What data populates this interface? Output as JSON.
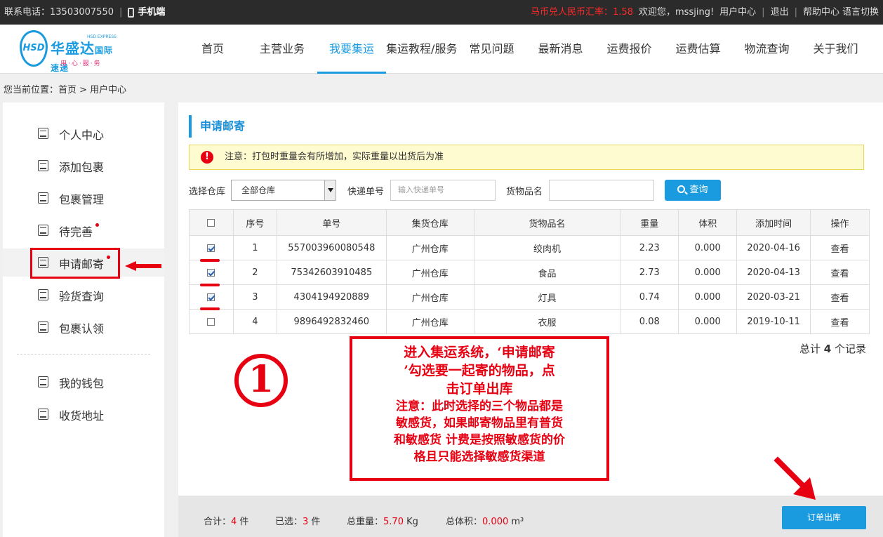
{
  "topbar": {
    "phone_label": "联系电话：13503007550",
    "mobile": "手机端",
    "rate_label": "马币兑人民币汇率：",
    "rate_value": "1.58",
    "welcome": "欢迎您，mssjing!",
    "user_center": "用户中心",
    "logout": "退出",
    "help": "帮助中心",
    "language": "语言切换"
  },
  "logo": {
    "badge": "HSD",
    "name": "华盛达",
    "subname": "国际速递",
    "en": "HSD EXPRESS",
    "slogan": "用·心·服·务"
  },
  "nav": [
    "首页",
    "主营业务",
    "我要集运",
    "集运教程/服务",
    "常见问题",
    "最新消息",
    "运费报价",
    "运费估算",
    "物流查询",
    "关于我们"
  ],
  "breadcrumb": "您当前位置：首页 > 用户中心",
  "sidebar": {
    "items": [
      "个人中心",
      "添加包裹",
      "包裹管理",
      "待完善",
      "申请邮寄",
      "验货查询",
      "包裹认领"
    ],
    "items2": [
      "我的钱包",
      "收货地址"
    ]
  },
  "panel": {
    "title": "申请邮寄",
    "notice": "注意：打包时重量会有所增加，实际重量以出货后为准",
    "notice_icon": "!"
  },
  "filter": {
    "warehouse_label": "选择仓库",
    "warehouse_value": "全部仓库",
    "tracking_label": "快递单号",
    "tracking_placeholder": "输入快递单号",
    "goods_label": "货物品名",
    "search_button": "查询"
  },
  "table": {
    "headers": [
      "序号",
      "单号",
      "集货仓库",
      "货物品名",
      "重量",
      "体积",
      "添加时间",
      "操作"
    ],
    "rows": [
      {
        "no": "1",
        "id": "557003960080548",
        "wh": "广州仓库",
        "name": "绞肉机",
        "weight": "2.23",
        "vol": "0.000",
        "date": "2020-04-16",
        "op": "查看"
      },
      {
        "no": "2",
        "id": "75342603910485",
        "wh": "广州仓库",
        "name": "食品",
        "weight": "2.73",
        "vol": "0.000",
        "date": "2020-04-13",
        "op": "查看"
      },
      {
        "no": "3",
        "id": "4304194920889",
        "wh": "广州仓库",
        "name": "灯具",
        "weight": "0.74",
        "vol": "0.000",
        "date": "2020-03-21",
        "op": "查看"
      },
      {
        "no": "4",
        "id": "9896492832460",
        "wh": "广州仓库",
        "name": "衣服",
        "weight": "0.08",
        "vol": "0.000",
        "date": "2019-10-11",
        "op": "查看"
      }
    ]
  },
  "total": {
    "pre": "总计 ",
    "count": "4",
    "post": " 个记录"
  },
  "annotation": {
    "step": "①",
    "line1": "进入集运系统，‘申请邮寄",
    "line2": "’勾选要一起寄的物品，点",
    "line3": "击订单出库",
    "line4": "注意：此时选择的三个物品都是",
    "line5": "敏感货，如果邮寄物品里有普货",
    "line6": "和敏感货 计费是按照敏感货的价",
    "line7": "格且只能选择敏感货渠道"
  },
  "bottom": {
    "total_label": "合计：",
    "total_val": "4",
    "total_unit": " 件",
    "sel_label": "已选：",
    "sel_val": "3",
    "sel_unit": " 件",
    "weight_label": "总重量：",
    "weight_val": "5.70",
    "weight_unit": " Kg",
    "vol_label": "总体积：",
    "vol_val": "0.000",
    "vol_unit": " m³",
    "order_button": "订单出库"
  },
  "colors": {
    "accent": "#1a9be0",
    "alert": "#e60012"
  }
}
